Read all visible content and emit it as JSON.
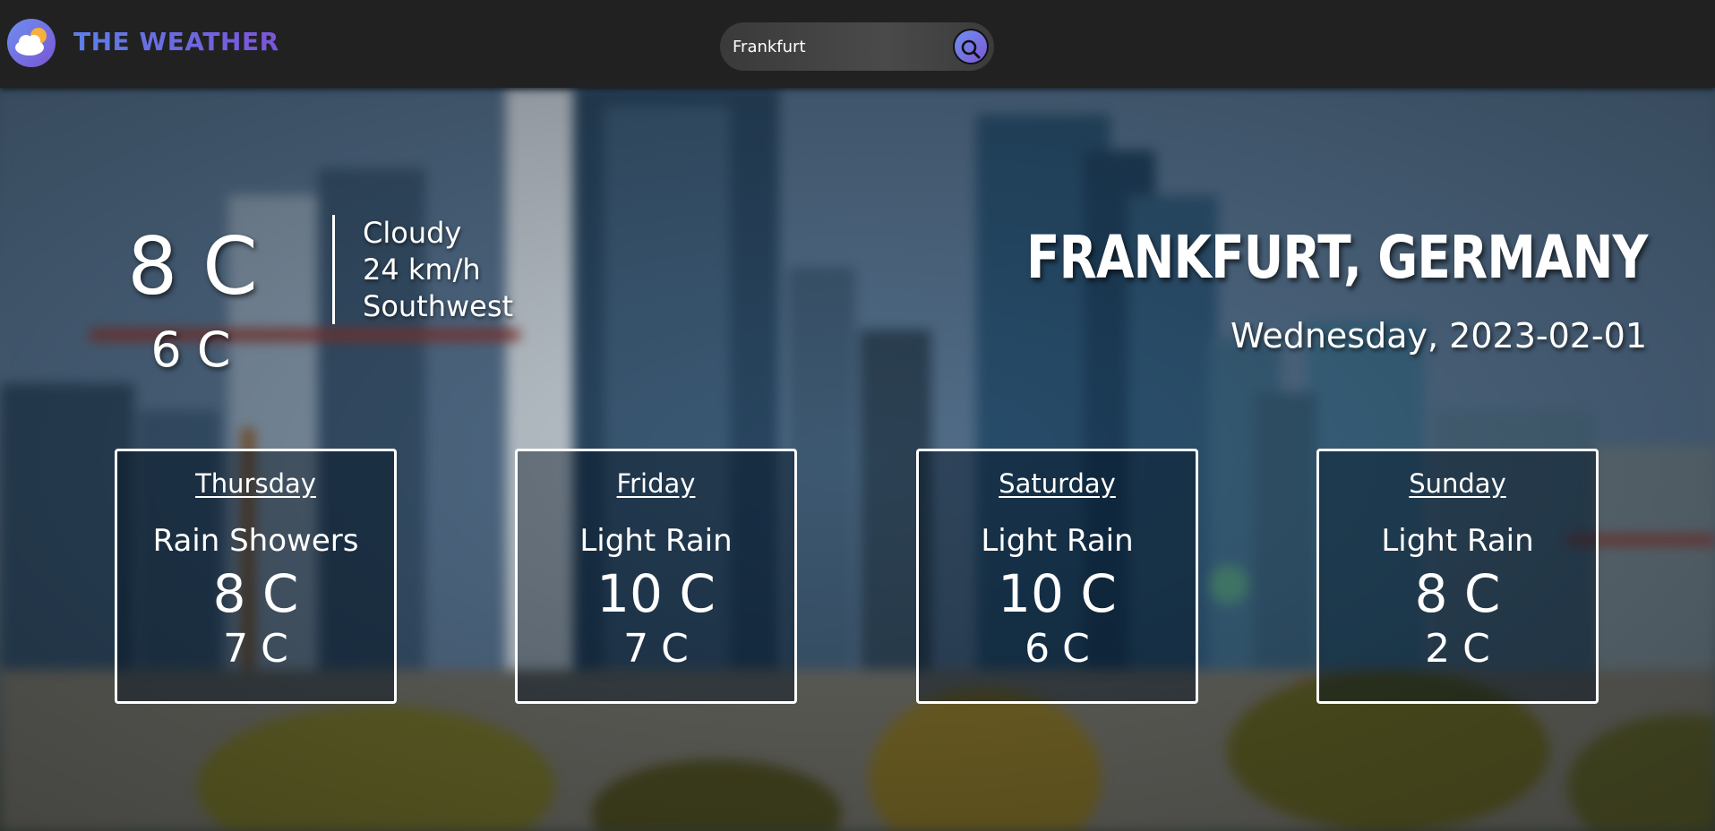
{
  "header": {
    "brand": "THE WEATHER",
    "logo_icon": "cloud-sun-icon",
    "search": {
      "value": "Frankfurt",
      "button_icon": "search-icon"
    }
  },
  "current": {
    "temperature": "8 C",
    "low": "6 C",
    "condition": "Cloudy",
    "wind_speed": "24 km/h",
    "wind_direction": "Southwest",
    "location": "Frankfurt, Germany",
    "date": "Wednesday, 2023-02-01"
  },
  "forecast": [
    {
      "day": "Thursday",
      "condition": "Rain Showers",
      "high": "8 C",
      "low": "7 C"
    },
    {
      "day": "Friday",
      "condition": "Light Rain",
      "high": "10 C",
      "low": "7 C"
    },
    {
      "day": "Saturday",
      "condition": "Light Rain",
      "high": "10 C",
      "low": "6 C"
    },
    {
      "day": "Sunday",
      "condition": "Light Rain",
      "high": "8 C",
      "low": "2 C"
    }
  ],
  "colors": {
    "header_bg": "#212121",
    "brand_gradient_start": "#5d7fe8",
    "brand_gradient_end": "#7b55d8",
    "text": "#ffffff"
  }
}
